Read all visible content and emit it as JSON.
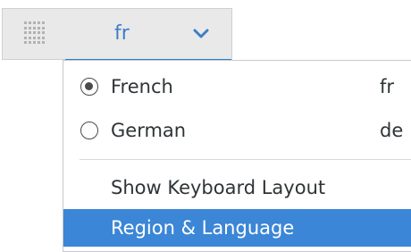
{
  "panel": {
    "layout_label": "fr",
    "grip_icon": "grip-dots-icon",
    "dropdown_icon": "chevron-down-icon"
  },
  "menu": {
    "languages": [
      {
        "label": "French",
        "code": "fr",
        "selected": true
      },
      {
        "label": "German",
        "code": "de",
        "selected": false
      }
    ],
    "actions": [
      {
        "label": "Show Keyboard Layout",
        "highlighted": false
      },
      {
        "label": "Region & Language",
        "highlighted": true
      }
    ]
  },
  "colors": {
    "accent": "#3c7fc7",
    "highlight_bg": "#3b86d6",
    "text": "#2e3436"
  }
}
